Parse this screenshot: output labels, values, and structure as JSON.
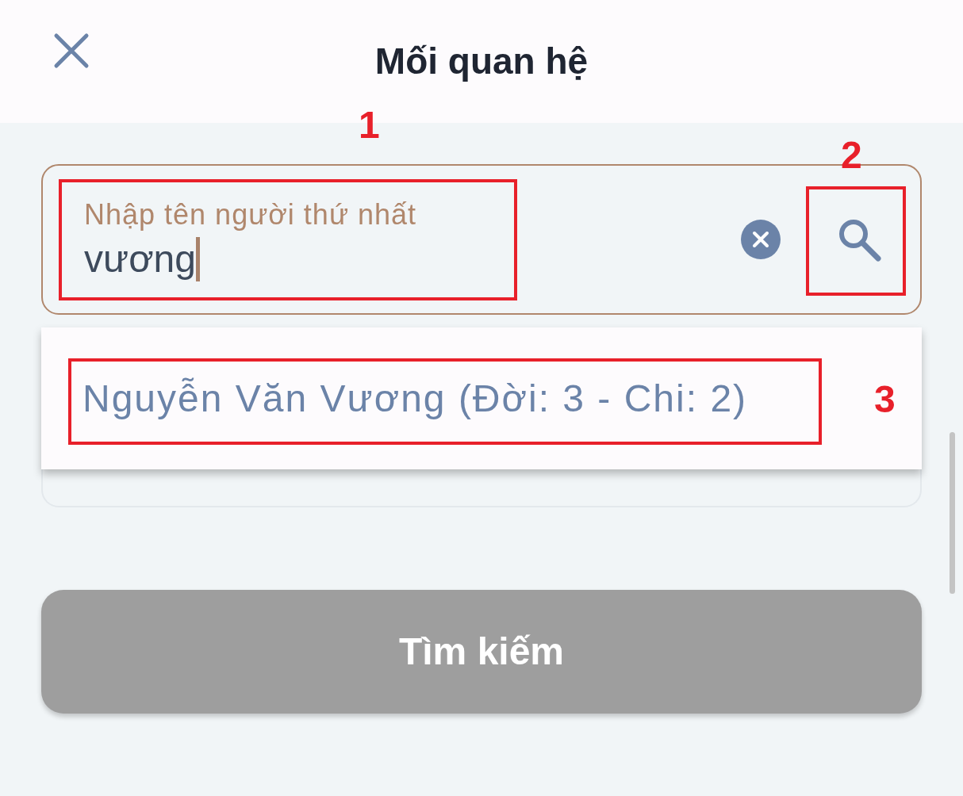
{
  "header": {
    "title": "Mối quan hệ"
  },
  "search": {
    "placeholder": "Nhập tên người thứ nhất",
    "value": "vương"
  },
  "suggestions": [
    {
      "text": "Nguyễn Văn Vương (Đời: 3 - Chi: 2)"
    }
  ],
  "search_button": {
    "label": "Tìm kiếm",
    "disabled": true
  },
  "annotations": [
    {
      "label": "1"
    },
    {
      "label": "2"
    },
    {
      "label": "3"
    }
  ]
}
